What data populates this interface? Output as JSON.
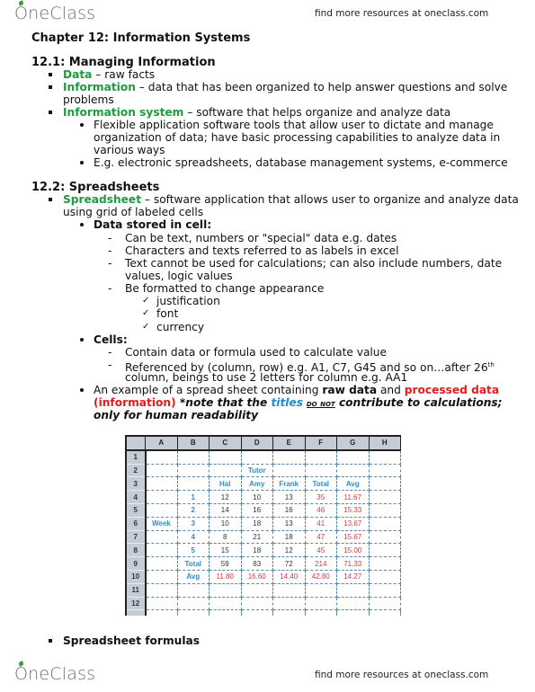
{
  "header": {
    "logo": "OneClass",
    "link": "find more resources at oneclass.com"
  },
  "footer": {
    "logo": "OneClass",
    "link": "find more resources at oneclass.com"
  },
  "chapter_title": "Chapter 12: Information Systems",
  "section1": {
    "heading": "12.1: Managing Information",
    "items": [
      {
        "term": "Data",
        "text": " – raw facts"
      },
      {
        "term": "Information",
        "text": " – data that has been organized to help answer questions and solve",
        "cont": "problems"
      },
      {
        "term": "Information system",
        "text": " – software that helps organize and analyze data"
      }
    ],
    "sub_items": [
      {
        "lines": [
          "Flexible application software tools that allow user to dictate and manage",
          "organization of data; have basic processing capabilities to analyze data in",
          "various ways"
        ]
      },
      {
        "lines": [
          "E.g. electronic spreadsheets, database management systems, e-commerce"
        ]
      }
    ]
  },
  "section2": {
    "heading": "12.2: Spreadsheets",
    "spreadsheet_term": "Spreadsheet",
    "spreadsheet_text": " – software application that allows user to organize and analyze data",
    "spreadsheet_cont": "using grid of labeled cells",
    "data_stored": {
      "heading": "Data stored in cell:",
      "points": [
        "Can be text, numbers or \"special\" data e.g. dates",
        "Characters and texts referred to as labels in excel",
        "Text cannot be used for calculations; can also include numbers, date",
        "values, logic values",
        "Be formatted to change appearance"
      ],
      "checks": [
        "justification",
        "font",
        "currency"
      ]
    },
    "cells": {
      "heading": "Cells:",
      "points": [
        "Contain data or formula used to calculate value",
        "Referenced by (column, row) e.g. A1, C7, G45 and so on…after 26",
        "column, beings to use 2 letters for column e.g. AA1"
      ],
      "sup": "th"
    },
    "example": {
      "t1": "An example of a spread sheet containing ",
      "raw": "raw data",
      "t2": " and ",
      "processed": "processed data",
      "information": "(information)",
      "note1": " *note that the ",
      "titles": "titles",
      "donot": "do not",
      "note2": " contribute to calculations;",
      "note3": "only for human readability"
    },
    "formulas": "Spreadsheet formulas"
  },
  "sheet": {
    "columns": [
      "",
      "A",
      "B",
      "C",
      "D",
      "E",
      "F",
      "G",
      "H"
    ],
    "rows": [
      {
        "n": "1",
        "cells": [
          "",
          "",
          "",
          "",
          "",
          "",
          "",
          ""
        ]
      },
      {
        "n": "2",
        "cells": [
          "",
          "",
          "",
          "Tutor",
          "",
          "",
          "",
          ""
        ]
      },
      {
        "n": "3",
        "cells": [
          "",
          "",
          "Hal",
          "Amy",
          "Frank",
          "Total",
          "Avg",
          ""
        ]
      },
      {
        "n": "4",
        "cells": [
          "",
          "1",
          "12",
          "10",
          "13",
          "35",
          "11.67",
          ""
        ]
      },
      {
        "n": "5",
        "cells": [
          "",
          "2",
          "14",
          "16",
          "16",
          "46",
          "15.33",
          ""
        ]
      },
      {
        "n": "6",
        "cells": [
          "Week",
          "3",
          "10",
          "18",
          "13",
          "41",
          "13.67",
          ""
        ]
      },
      {
        "n": "7",
        "cells": [
          "",
          "4",
          "8",
          "21",
          "18",
          "47",
          "15.67",
          ""
        ]
      },
      {
        "n": "8",
        "cells": [
          "",
          "5",
          "15",
          "18",
          "12",
          "45",
          "15.00",
          ""
        ]
      },
      {
        "n": "9",
        "cells": [
          "",
          "Total",
          "59",
          "83",
          "72",
          "214",
          "71.33",
          ""
        ]
      },
      {
        "n": "10",
        "cells": [
          "",
          "Avg",
          "11.80",
          "16.60",
          "14.40",
          "42.80",
          "14.27",
          ""
        ]
      },
      {
        "n": "11",
        "cells": [
          "",
          "",
          "",
          "",
          "",
          "",
          "",
          ""
        ]
      },
      {
        "n": "12",
        "cells": [
          "",
          "",
          "",
          "",
          "",
          "",
          "",
          ""
        ]
      }
    ]
  }
}
